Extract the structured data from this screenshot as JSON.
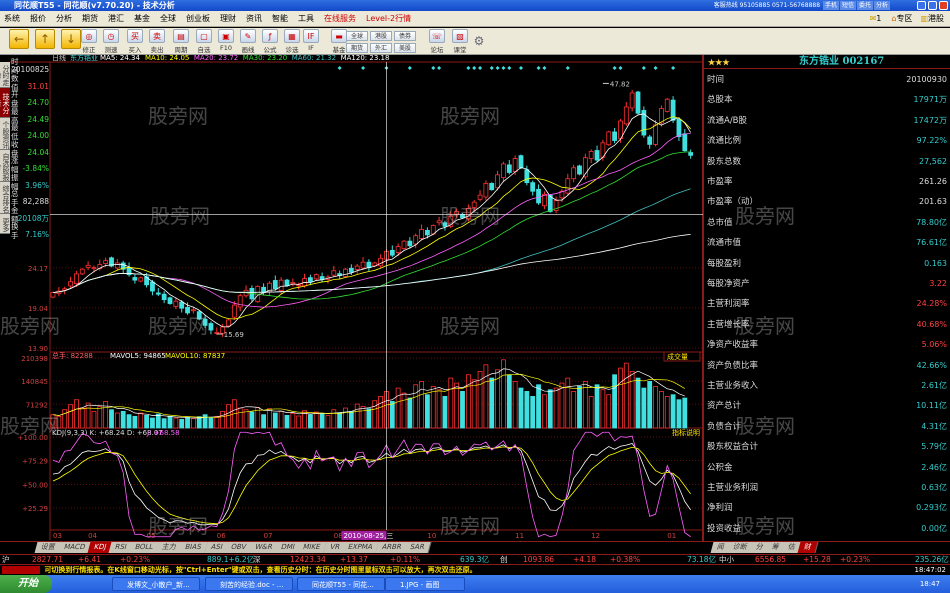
{
  "window": {
    "title": "同花顺T55 - 同花顺(v7.70.20) - 技术分析",
    "hotline": "客服热线 95105885 0571-56768888",
    "title_buttons": [
      "手机",
      "短信",
      "委托",
      "分析"
    ]
  },
  "menu": {
    "items": [
      "系统",
      "报价",
      "分析",
      "期货",
      "港汇",
      "基金",
      "全球",
      "创业板",
      "理财",
      "资讯",
      "智能",
      "工具"
    ],
    "red_items": [
      "在线服务",
      "Level-2行情"
    ],
    "right": {
      "mail_count": "1",
      "zone": "专区",
      "hk": "港股"
    }
  },
  "toolbar": {
    "buttons": [
      "修正",
      "测速",
      "买入",
      "卖出",
      "周期",
      "自选",
      "F10",
      "画线",
      "公式",
      "诊选",
      "IF",
      "基金",
      "论坛",
      "课堂"
    ],
    "small_buttons": [
      "全球",
      "港股",
      "债券",
      "期货",
      "外汇",
      "美股"
    ]
  },
  "sidetabs": [
    "分时走势",
    "技术分析",
    "个股资讯",
    "自选股报价",
    "综合排名",
    "更多"
  ],
  "info_panel": [
    {
      "label": "时间",
      "value": "20100825"
    },
    {
      "label": "数值",
      "value": "31.01",
      "color": "#ff4040"
    },
    {
      "label": "开盘",
      "value": "24.70",
      "color": "#30e030"
    },
    {
      "label": "最高",
      "value": "24.49",
      "color": "#30e030"
    },
    {
      "label": "最低",
      "value": "24.00",
      "color": "#30e030"
    },
    {
      "label": "收盘",
      "value": "24.04",
      "color": "#30e030"
    },
    {
      "label": "涨幅",
      "value": "-3.84%",
      "color": "#30e030"
    },
    {
      "label": "振幅",
      "value": "3.96%",
      "color": "#3cc"
    },
    {
      "label": "总手",
      "value": "82,288",
      "color": "#ddd"
    },
    {
      "label": "金额",
      "value": "20108万",
      "color": "#3cc"
    },
    {
      "label": "换手",
      "value": "7.16%",
      "color": "#3cc"
    }
  ],
  "chart_header": {
    "period": "日线",
    "stock": "东方锆业",
    "ma": [
      {
        "label": "MA5: 24.34",
        "color": "#ffffff"
      },
      {
        "label": "MA10: 24.05",
        "color": "#ffff00"
      },
      {
        "label": "MA20: 23.72",
        "color": "#ff60ff"
      },
      {
        "label": "MA30: 23.20",
        "color": "#30e030"
      },
      {
        "label": "MA60: 21.32",
        "color": "#40c0c0"
      },
      {
        "label": "MA120: 23.18",
        "color": "#ffffff"
      }
    ]
  },
  "volume_header": {
    "text": "总手: 82288",
    "mavol5": "MAVOL5: 94865",
    "mavol10": "MAVOL10: 87837",
    "tag": "成交量"
  },
  "kdj_header": {
    "text": "KDJ(9,3,3) K: +68.24 D: +68.07",
    "j": "J: +68.58",
    "tag": "指标说明"
  },
  "crosshair_date": "2010-08-25,三",
  "chart_data": {
    "type": "candlestick",
    "price_axis": {
      "labels": [
        "24.17",
        "19.04",
        "13.90"
      ],
      "values": [
        24.17,
        19.04,
        13.9
      ]
    },
    "volume_axis": {
      "labels": [
        "210398",
        "140845",
        "71292"
      ],
      "values": [
        210398,
        140845,
        71292
      ]
    },
    "kdj_axis": {
      "labels": [
        "+100.00",
        "+75.29",
        "+50.00",
        "+25.29"
      ],
      "values": [
        100,
        75.29,
        50,
        25.29
      ]
    },
    "x_labels": [
      "03",
      "04",
      "05",
      "06",
      "07",
      "08",
      "09",
      "10",
      "11",
      "12",
      "01"
    ],
    "x_label_index": [
      0,
      6,
      16,
      28,
      36,
      48,
      54,
      64,
      79,
      92,
      105
    ],
    "crosshair_index": 57,
    "crosshair_price": 31.01,
    "annotations": [
      {
        "label": "47.82",
        "index": 94,
        "price": 47.82
      },
      {
        "label": "15.69",
        "index": 28,
        "price": 15.69
      }
    ],
    "signal_markers": [
      49,
      53,
      57,
      61,
      65,
      66,
      71,
      72,
      73,
      75,
      76,
      77,
      78,
      80,
      83,
      84,
      88,
      96,
      97,
      101,
      103,
      106
    ],
    "closes": [
      21.0,
      21.2,
      21.5,
      22.4,
      23.4,
      24.0,
      24.5,
      24.2,
      24.6,
      25.1,
      24.4,
      24.8,
      24.0,
      23.3,
      22.6,
      22.9,
      22.0,
      21.2,
      20.8,
      20.1,
      19.6,
      19.9,
      19.0,
      18.4,
      18.8,
      17.6,
      16.8,
      16.2,
      15.9,
      16.6,
      17.5,
      19.4,
      20.6,
      21.3,
      20.2,
      21.8,
      21.0,
      22.2,
      21.5,
      22.6,
      21.9,
      22.3,
      22.0,
      22.8,
      22.4,
      23.3,
      22.7,
      23.0,
      23.8,
      23.2,
      24.0,
      23.6,
      24.4,
      24.9,
      24.2,
      24.8,
      25.4,
      26.3,
      25.8,
      26.9,
      27.6,
      27.0,
      28.3,
      29.1,
      28.4,
      29.6,
      30.2,
      29.5,
      30.8,
      31.4,
      30.6,
      31.8,
      32.6,
      33.5,
      35.0,
      34.2,
      36.1,
      37.5,
      36.4,
      38.2,
      37.0,
      35.1,
      34.0,
      32.5,
      33.6,
      31.4,
      32.8,
      34.0,
      35.6,
      37.0,
      36.2,
      38.3,
      39.1,
      38.0,
      40.2,
      41.6,
      40.5,
      43.0,
      44.8,
      46.6,
      44.0,
      41.2,
      40.0,
      42.5,
      44.6,
      45.8,
      43.1,
      41.0,
      39.2,
      38.6
    ],
    "volumes_k": [
      40,
      35,
      55,
      70,
      85,
      60,
      75,
      50,
      65,
      80,
      55,
      45,
      50,
      40,
      35,
      45,
      38,
      30,
      42,
      28,
      35,
      30,
      26,
      32,
      28,
      34,
      40,
      30,
      35,
      50,
      70,
      85,
      60,
      55,
      48,
      62,
      40,
      58,
      45,
      50,
      38,
      44,
      36,
      52,
      40,
      48,
      42,
      38,
      55,
      46,
      60,
      50,
      72,
      65,
      58,
      82,
      95,
      110,
      80,
      120,
      105,
      90,
      130,
      140,
      100,
      125,
      115,
      95,
      150,
      135,
      110,
      160,
      145,
      170,
      190,
      150,
      175,
      205,
      160,
      140,
      120,
      110,
      95,
      130,
      100,
      115,
      120,
      135,
      150,
      110,
      125,
      140,
      95,
      130,
      115,
      100,
      160,
      180,
      195,
      170,
      150,
      120,
      140,
      125,
      110,
      95,
      100,
      85,
      90
    ]
  },
  "right_panel": {
    "stars": "★★★",
    "title": "东方锆业 002167",
    "rows": [
      {
        "label": "时间",
        "value": "20100930",
        "color": "#ddd"
      },
      {
        "label": "总股本",
        "value": "17971万",
        "color": "#3cc"
      },
      {
        "label": "流通A/B股",
        "value": "17472万",
        "color": "#3cc"
      },
      {
        "label": "流通比例",
        "value": "97.22%",
        "color": "#3cc"
      },
      {
        "label": "股东总数",
        "value": "27,562",
        "color": "#3cc"
      },
      {
        "label": "市盈率",
        "value": "261.26",
        "color": "#ddd"
      },
      {
        "label": "市盈率（动）",
        "value": "201.63",
        "color": "#ddd"
      },
      {
        "label": "总市值",
        "value": "78.80亿",
        "color": "#3cc"
      },
      {
        "label": "流通市值",
        "value": "76.61亿",
        "color": "#3cc"
      },
      {
        "label": "每股盈利",
        "value": "0.163",
        "color": "#3cc"
      },
      {
        "label": "每股净资产",
        "value": "3.22",
        "color": "#ff4040"
      },
      {
        "label": "主营利润率",
        "value": "24.28%",
        "color": "#ff4040"
      },
      {
        "label": "主营增长率",
        "value": "40.68%",
        "color": "#ff4040"
      },
      {
        "label": "净资产收益率",
        "value": "5.06%",
        "color": "#ff4040"
      },
      {
        "label": "资产负债比率",
        "value": "42.66%",
        "color": "#3cc"
      },
      {
        "label": "主营业务收入",
        "value": "2.61亿",
        "color": "#3cc"
      },
      {
        "label": "资产总计",
        "value": "10.11亿",
        "color": "#3cc"
      },
      {
        "label": "负债合计",
        "value": "4.31亿",
        "color": "#3cc"
      },
      {
        "label": "股东权益合计",
        "value": "5.79亿",
        "color": "#3cc"
      },
      {
        "label": "公积金",
        "value": "2.46亿",
        "color": "#3cc"
      },
      {
        "label": "主营业务利润",
        "value": "0.63亿",
        "color": "#3cc"
      },
      {
        "label": "净利润",
        "value": "0.293亿",
        "color": "#3cc"
      },
      {
        "label": "投资收益",
        "value": "0.00亿",
        "color": "#3cc"
      }
    ],
    "tabs": [
      "闻",
      "诊断",
      "分",
      "筹",
      "估",
      "财"
    ]
  },
  "indicator_tabs": [
    "设置",
    "MACD",
    "KDJ",
    "RSI",
    "BOLL",
    "主力",
    "BIAS",
    "ASI",
    "OBV",
    "W&R",
    "DMI",
    "MIKE",
    "VR",
    "EXPMA",
    "ARBR",
    "SAR"
  ],
  "index_bar": [
    {
      "text": "沪",
      "color": "#ddd"
    },
    {
      "text": "2827.71",
      "color": "#ff4040"
    },
    {
      "text": "+6.41",
      "color": "#ff4040"
    },
    {
      "text": "+0.23%",
      "color": "#ff4040"
    },
    {
      "text": "889.1+6.2亿",
      "color": "#3cc"
    },
    {
      "text": "深",
      "color": "#ddd"
    },
    {
      "text": "12423.34",
      "color": "#ff4040"
    },
    {
      "text": "+13.37",
      "color": "#ff4040"
    },
    {
      "text": "+0.11%",
      "color": "#ff4040"
    },
    {
      "text": "639.3亿",
      "color": "#3cc"
    },
    {
      "text": "创",
      "color": "#ddd"
    },
    {
      "text": "1093.86",
      "color": "#ff4040"
    },
    {
      "text": "+4.18",
      "color": "#ff4040"
    },
    {
      "text": "+0.38%",
      "color": "#ff4040"
    },
    {
      "text": "73.18亿",
      "color": "#3cc"
    },
    {
      "text": "中小",
      "color": "#ddd"
    },
    {
      "text": "6556.85",
      "color": "#ff4040"
    },
    {
      "text": "+15.28",
      "color": "#ff4040"
    },
    {
      "text": "+0.23%",
      "color": "#ff4040"
    },
    {
      "text": "235.26亿",
      "color": "#3cc"
    }
  ],
  "message": "可切换到行情报表。在K线窗口移动光标，按\"Ctrl+Enter\"键或双击，查看历史分时：在历史分时图里鼠标双击可以放大，再次双击还原。",
  "clock": "18:47:02",
  "taskbar": {
    "start": "开始",
    "tasks": [
      "发博文_小散户_新...",
      "刻苦的经验.doc - ...",
      "同花顺T55 - 同花...",
      "1.JPG - 画图"
    ],
    "time": "18:47"
  },
  "watermark": "股旁网"
}
